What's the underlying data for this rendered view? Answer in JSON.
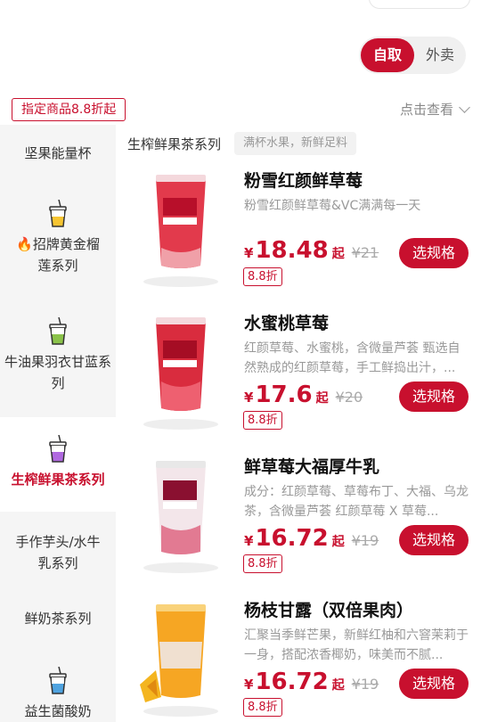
{
  "mode": {
    "pickup": "自取",
    "delivery": "外卖"
  },
  "promo_tag": "指定商品8.8折起",
  "click_view": "点击查看",
  "section": {
    "title": "生榨鲜果茶系列",
    "tag": "满杯水果，新鲜足料"
  },
  "sidebar": {
    "items": [
      {
        "label": "坚果能量杯"
      },
      {
        "label": "🔥招牌黄金榴莲系列"
      },
      {
        "label": "牛油果羽衣甘蓝系列"
      },
      {
        "label": "生榨鲜果茶系列"
      },
      {
        "label": "手作芋头/水牛乳系列"
      },
      {
        "label": "鲜奶茶系列"
      },
      {
        "label": "益生菌酸奶"
      }
    ],
    "active_index": 3
  },
  "products": [
    {
      "name": "粉雪红颜鲜草莓",
      "desc": "粉雪红颜鲜草莓&VC满满每一天",
      "yen": "¥",
      "price": "18.48",
      "qi": "起",
      "orig": "¥21",
      "discount": "8.8折",
      "button": "选规格"
    },
    {
      "name": "水蜜桃草莓",
      "desc": "红颜草莓、水蜜桃，含微量芦荟 甄选自然熟成的红颜草莓，手工鲜捣出汁，...",
      "yen": "¥",
      "price": "17.6",
      "qi": "起",
      "orig": "¥20",
      "discount": "8.8折",
      "button": "选规格"
    },
    {
      "name": "鲜草莓大福厚牛乳",
      "desc": "成分：红颜草莓、草莓布丁、大福、乌龙茶，含微量芦荟 红颜草莓 X 草莓...",
      "yen": "¥",
      "price": "16.72",
      "qi": "起",
      "orig": "¥19",
      "discount": "8.8折",
      "button": "选规格"
    },
    {
      "name": "杨枝甘露（双倍果肉）",
      "desc": "汇聚当季鲜芒果，新鲜红柚和六窨茉莉于一身，搭配浓香椰奶，味美而不腻...",
      "yen": "¥",
      "price": "16.72",
      "qi": "起",
      "orig": "¥19",
      "discount": "8.8折",
      "button": "选规格"
    }
  ],
  "colors": {
    "accent": "#c8102e",
    "sidebar_bg": "#f5f5f5"
  }
}
